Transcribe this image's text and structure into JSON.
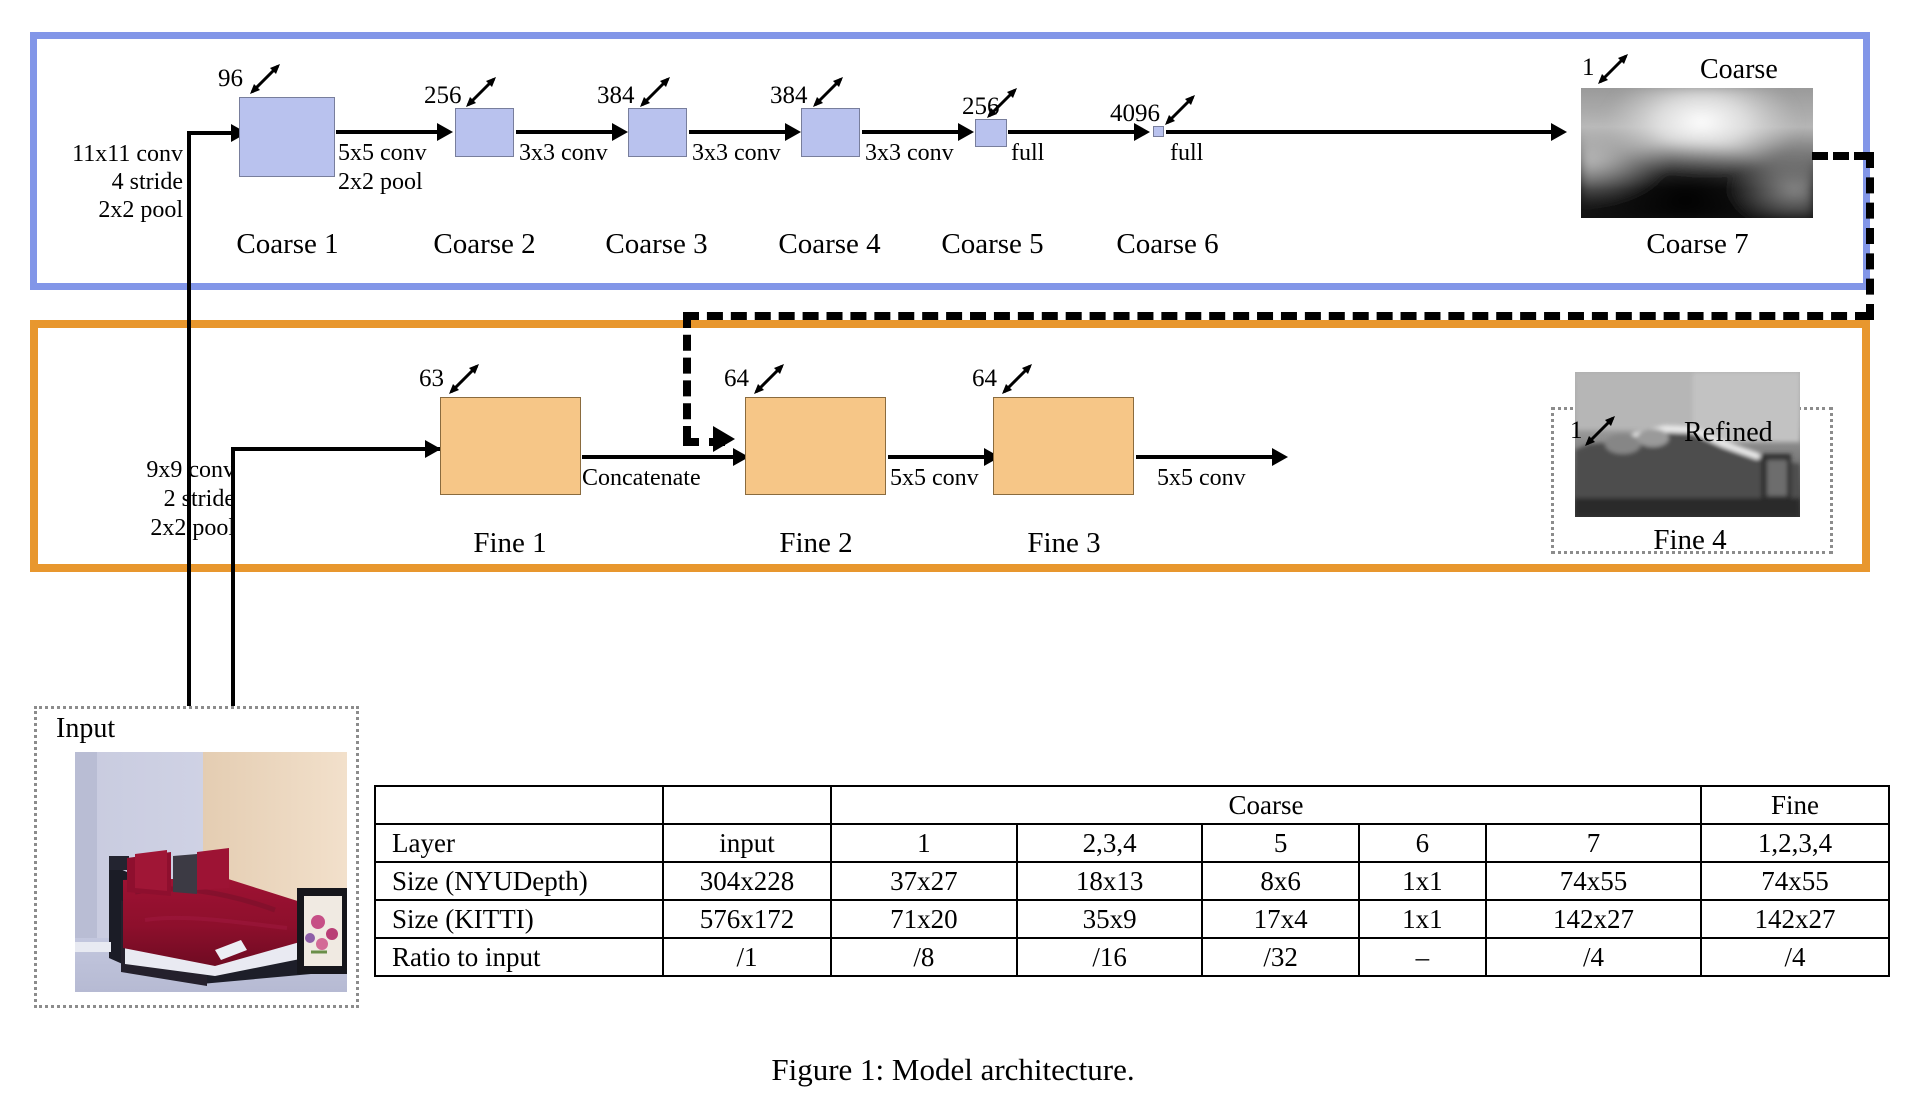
{
  "figure": {
    "caption": "Figure 1: Model architecture."
  },
  "coarse_stack": {
    "title": "Coarse",
    "input_op": [
      "11x11 conv",
      "4 stride",
      "2x2 pool"
    ],
    "layers": [
      {
        "name": "Coarse 1",
        "channels": "96",
        "op": [
          "5x5 conv",
          "2x2 pool"
        ]
      },
      {
        "name": "Coarse 2",
        "channels": "256",
        "op": [
          "3x3 conv"
        ]
      },
      {
        "name": "Coarse 3",
        "channels": "384",
        "op": [
          "3x3 conv"
        ]
      },
      {
        "name": "Coarse 4",
        "channels": "384",
        "op": [
          "3x3 conv"
        ]
      },
      {
        "name": "Coarse 5",
        "channels": "256",
        "op": [
          "full"
        ]
      },
      {
        "name": "Coarse 6",
        "channels": "4096",
        "op": [
          "full"
        ]
      },
      {
        "name": "Coarse 7",
        "channels": "1",
        "op": []
      }
    ]
  },
  "fine_stack": {
    "title": "Refined",
    "input_op": [
      "9x9 conv",
      "2 stride",
      "2x2 pool"
    ],
    "layers": [
      {
        "name": "Fine 1",
        "channels": "63",
        "op": [
          "Concatenate"
        ]
      },
      {
        "name": "Fine 2",
        "channels": "64",
        "op": [
          "5x5 conv"
        ]
      },
      {
        "name": "Fine 3",
        "channels": "64",
        "op": [
          "5x5 conv"
        ]
      },
      {
        "name": "Fine 4",
        "channels": "1",
        "op": []
      }
    ]
  },
  "input_panel": {
    "label": "Input"
  },
  "table": {
    "group_headers": {
      "blank": "",
      "input": "",
      "coarse": "Coarse",
      "fine": "Fine"
    },
    "rows": [
      {
        "label": "Layer",
        "input": "input",
        "c1": "1",
        "c234": "2,3,4",
        "c5": "5",
        "c6": "6",
        "c7": "7",
        "fine": "1,2,3,4"
      },
      {
        "label": "Size (NYUDepth)",
        "input": "304x228",
        "c1": "37x27",
        "c234": "18x13",
        "c5": "8x6",
        "c6": "1x1",
        "c7": "74x55",
        "fine": "74x55"
      },
      {
        "label": "Size (KITTI)",
        "input": "576x172",
        "c1": "71x20",
        "c234": "35x9",
        "c5": "17x4",
        "c6": "1x1",
        "c7": "142x27",
        "fine": "142x27"
      },
      {
        "label": "Ratio to input",
        "input": "/1",
        "c1": "/8",
        "c234": "/16",
        "c5": "/32",
        "c6": "–",
        "c7": "/4",
        "fine": "/4"
      }
    ]
  },
  "colors": {
    "coarse_border": "#8296e8",
    "fine_border": "#e8972e",
    "coarse_block": "#b9c2ee",
    "fine_block": "#f6c687"
  }
}
